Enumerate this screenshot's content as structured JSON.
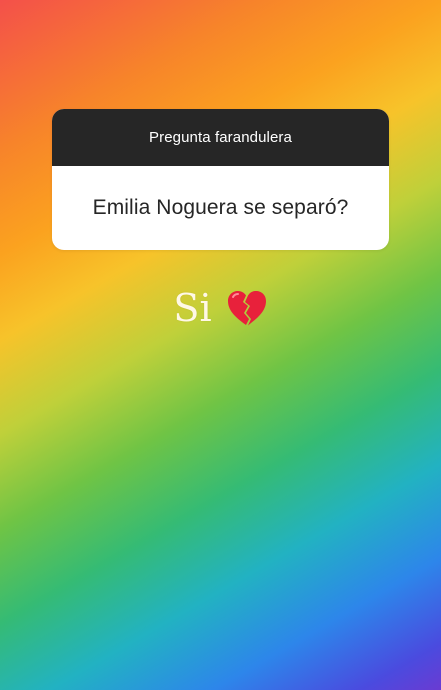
{
  "story": {
    "question_header": "Pregunta farandulera",
    "question_text": "Emilia Noguera se separó?",
    "answer_text": "Si",
    "answer_icon": "broken-heart-icon"
  },
  "colors": {
    "card_header_bg": "#262626",
    "card_body_bg": "#ffffff",
    "heart_red": "#e8213b"
  }
}
